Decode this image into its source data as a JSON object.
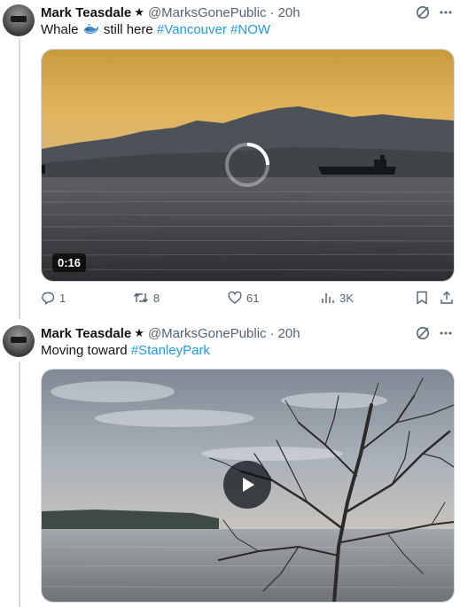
{
  "tweets": [
    {
      "author": "Mark Teasdale",
      "verified_glyph": "★",
      "handle": "@MarksGonePublic",
      "separator": "·",
      "time": "20h",
      "text_before": "Whale",
      "text_middle": " still here ",
      "hashtags": [
        "#Vancouver",
        "#NOW"
      ],
      "media": {
        "kind": "video",
        "duration": "0:16",
        "state": "loading"
      },
      "stats": {
        "replies": "1",
        "reposts": "8",
        "likes": "61",
        "views": "3K"
      }
    },
    {
      "author": "Mark Teasdale",
      "verified_glyph": "★",
      "handle": "@MarksGonePublic",
      "separator": "·",
      "time": "20h",
      "text_before": "Moving toward ",
      "hashtags": [
        "#StanleyPark"
      ],
      "media": {
        "kind": "video",
        "state": "paused"
      }
    }
  ],
  "icons": {
    "grok": "grok-icon",
    "more": "more-icon",
    "whale": "whale-emoji-icon",
    "reply": "reply-icon",
    "repost": "repost-icon",
    "like": "like-icon",
    "views": "views-icon",
    "bookmark": "bookmark-icon",
    "share": "share-icon",
    "play": "play-icon",
    "spinner": "loading-spinner-icon"
  },
  "colors": {
    "link": "#1d9bf0",
    "secondary_text": "#536471",
    "divider": "#cfd9de"
  }
}
